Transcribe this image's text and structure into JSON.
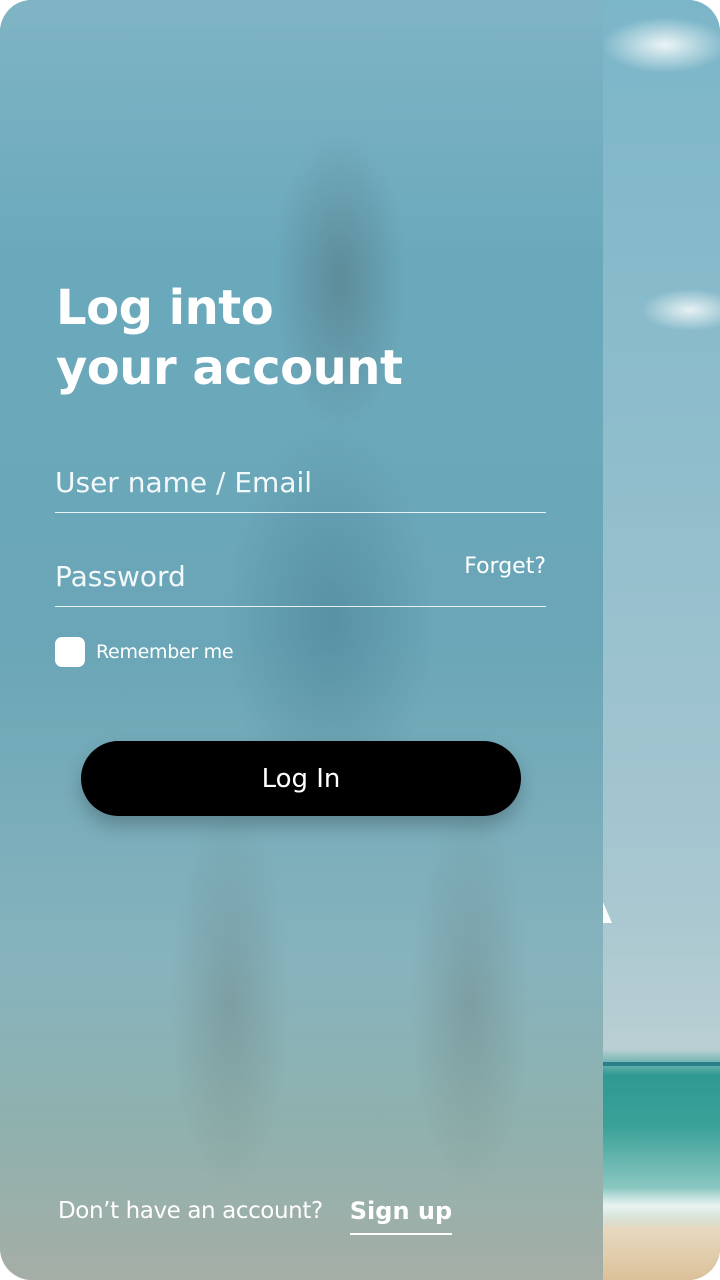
{
  "header": {
    "title_line1": "Log into",
    "title_line2": "your account"
  },
  "form": {
    "username": {
      "placeholder": "User name / Email",
      "value": ""
    },
    "password": {
      "placeholder": "Password",
      "value": ""
    },
    "forget_label": "Forget?",
    "remember_label": "Remember me",
    "remember_checked": false,
    "login_label": "Log In"
  },
  "footer": {
    "prompt": "Don’t have an account?",
    "signup_label": "Sign up"
  },
  "colors": {
    "button_bg": "#000000",
    "text": "#ffffff"
  }
}
